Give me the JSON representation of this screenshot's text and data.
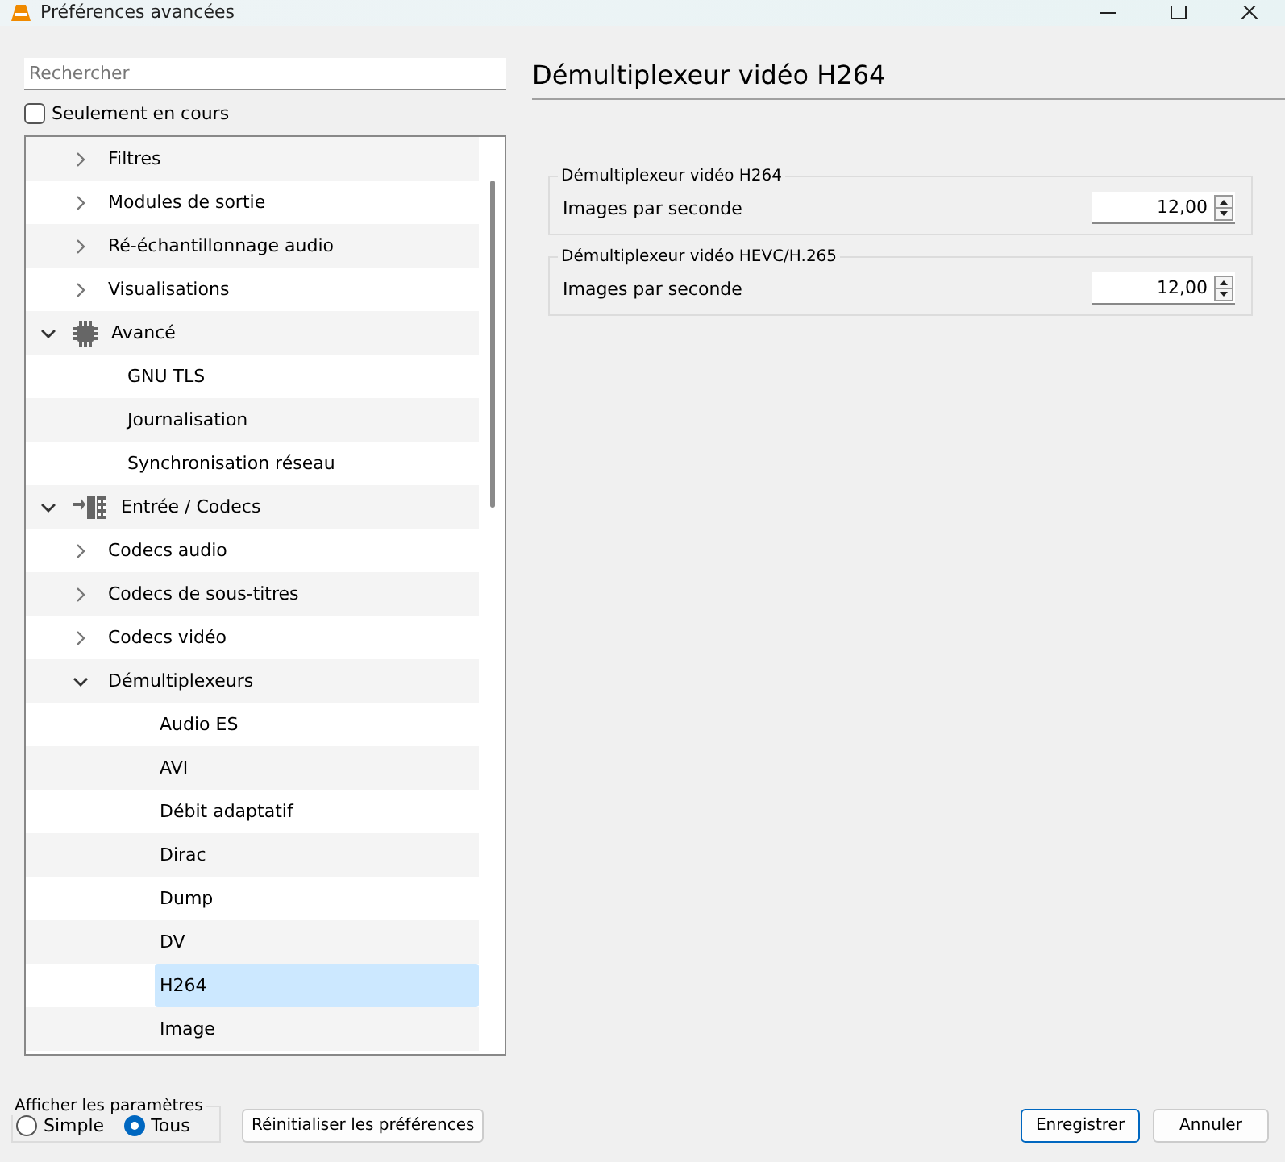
{
  "window": {
    "title": "Préférences avancées"
  },
  "search": {
    "placeholder": "Rechercher"
  },
  "only_current": {
    "label": "Seulement en cours",
    "checked": false
  },
  "tree": {
    "continued_children": [
      {
        "label": "Filtres",
        "expanded": false,
        "selected": false
      },
      {
        "label": "Modules de sortie",
        "expanded": false,
        "selected": false
      },
      {
        "label": "Ré-échantillonnage audio",
        "expanded": false,
        "selected": false
      },
      {
        "label": "Visualisations",
        "expanded": false,
        "selected": false
      }
    ],
    "items": [
      {
        "label": "Avancé",
        "kind": "category",
        "expanded": true,
        "selected": false,
        "children": [
          {
            "label": "GNU TLS",
            "selected": false
          },
          {
            "label": "Journalisation",
            "selected": false
          },
          {
            "label": "Synchronisation réseau",
            "selected": false
          }
        ]
      },
      {
        "label": "Entrée / Codecs",
        "kind": "category",
        "expanded": true,
        "selected": false,
        "children": [
          {
            "label": "Codecs audio",
            "expanded": false,
            "selected": false
          },
          {
            "label": "Codecs de sous-titres",
            "expanded": false,
            "selected": false
          },
          {
            "label": "Codecs vidéo",
            "expanded": false,
            "selected": false
          },
          {
            "label": "Démultiplexeurs",
            "expanded": true,
            "selected": false,
            "children": [
              {
                "label": "Audio ES",
                "selected": false
              },
              {
                "label": "AVI",
                "selected": false
              },
              {
                "label": "Débit adaptatif",
                "selected": false
              },
              {
                "label": "Dirac",
                "selected": false
              },
              {
                "label": "Dump",
                "selected": false
              },
              {
                "label": "DV",
                "selected": false
              },
              {
                "label": "H264",
                "selected": true
              },
              {
                "label": "Image",
                "selected": false
              }
            ]
          }
        ]
      }
    ]
  },
  "panel": {
    "title": "Démultiplexeur vidéo H264",
    "groups": [
      {
        "title": "Démultiplexeur vidéo H264",
        "field_label": "Images par seconde",
        "value": "12,00"
      },
      {
        "title": "Démultiplexeur vidéo HEVC/H.265",
        "field_label": "Images par seconde",
        "value": "12,00"
      }
    ]
  },
  "show_settings": {
    "title": "Afficher les paramètres",
    "options": [
      {
        "label": "Simple",
        "selected": false
      },
      {
        "label": "Tous",
        "selected": true
      }
    ]
  },
  "buttons": {
    "reset": "Réinitialiser les préférences",
    "save": "Enregistrer",
    "cancel": "Annuler"
  }
}
